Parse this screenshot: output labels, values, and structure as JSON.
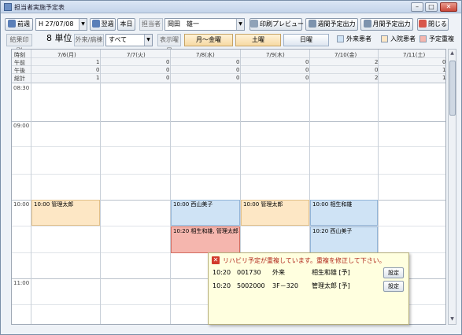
{
  "window": {
    "title": "担当者実施予定表",
    "min_glyph": "–",
    "max_glyph": "□",
    "close_glyph": "✕"
  },
  "toolbar": {
    "prev_week": "前週",
    "date_value": "H 27/07/08",
    "next_week": "翌週",
    "today": "本日",
    "staff_label": "担当者",
    "staff_value": "岡田　雄一",
    "print_preview": "印刷プレビュー",
    "weekly_output": "週間予定出力",
    "monthly_output": "月間予定出力",
    "close": "閉じる",
    "calc_label": "結果印刷",
    "units": "8 単位",
    "category_label": "外来/病棟",
    "category_value": "すべて",
    "display_day_label": "表示曜日",
    "tab_weekdays": "月～金曜",
    "tab_saturday": "土曜",
    "tab_sunday": "日曜",
    "legend": [
      {
        "label": "外来患者",
        "color": "#cfe3f5"
      },
      {
        "label": "入院患者",
        "color": "#fde7c5"
      },
      {
        "label": "予定重複",
        "color": "#f5b6ae"
      }
    ]
  },
  "schedule": {
    "header_time": "時刻",
    "row_labels": [
      "午前",
      "午後",
      "総計"
    ],
    "days": [
      {
        "label": "7/6(月)",
        "am": "1",
        "pm": "0",
        "total": "1"
      },
      {
        "label": "7/7(火)",
        "am": "0",
        "pm": "0",
        "total": "0"
      },
      {
        "label": "7/8(水)",
        "am": "0",
        "pm": "0",
        "total": "0"
      },
      {
        "label": "7/9(木)",
        "am": "0",
        "pm": "0",
        "total": "0"
      },
      {
        "label": "7/10(金)",
        "am": "2",
        "pm": "0",
        "total": "2"
      },
      {
        "label": "7/11(土)",
        "am": "0",
        "pm": "1",
        "total": "1"
      }
    ],
    "times": [
      "08:30",
      "09:00",
      "10:00",
      "11:00"
    ],
    "appointments": [
      {
        "text": "10:00 管理太郎",
        "type": "in"
      },
      {
        "text": "10:00 西山美子",
        "type": "out"
      },
      {
        "text": "10:20 相生和雄, 管理太郎",
        "type": "dup"
      },
      {
        "text": "10:00 管理太郎",
        "type": "in"
      },
      {
        "text": "10:00 相生和雄",
        "type": "out"
      },
      {
        "text": "10:20 西山美子",
        "type": "out"
      }
    ]
  },
  "conflict_popup": {
    "message": "リハビリ予定が重複しています。重複を修正して下さい。",
    "rows": [
      {
        "time": "10:20",
        "id": "001730",
        "ward": "外来",
        "name": "相生和雄 [予]",
        "button": "設定"
      },
      {
        "time": "10:20",
        "id": "5002000",
        "ward": "3F－320",
        "name": "管理太郎 [予]",
        "button": "設定"
      }
    ]
  }
}
